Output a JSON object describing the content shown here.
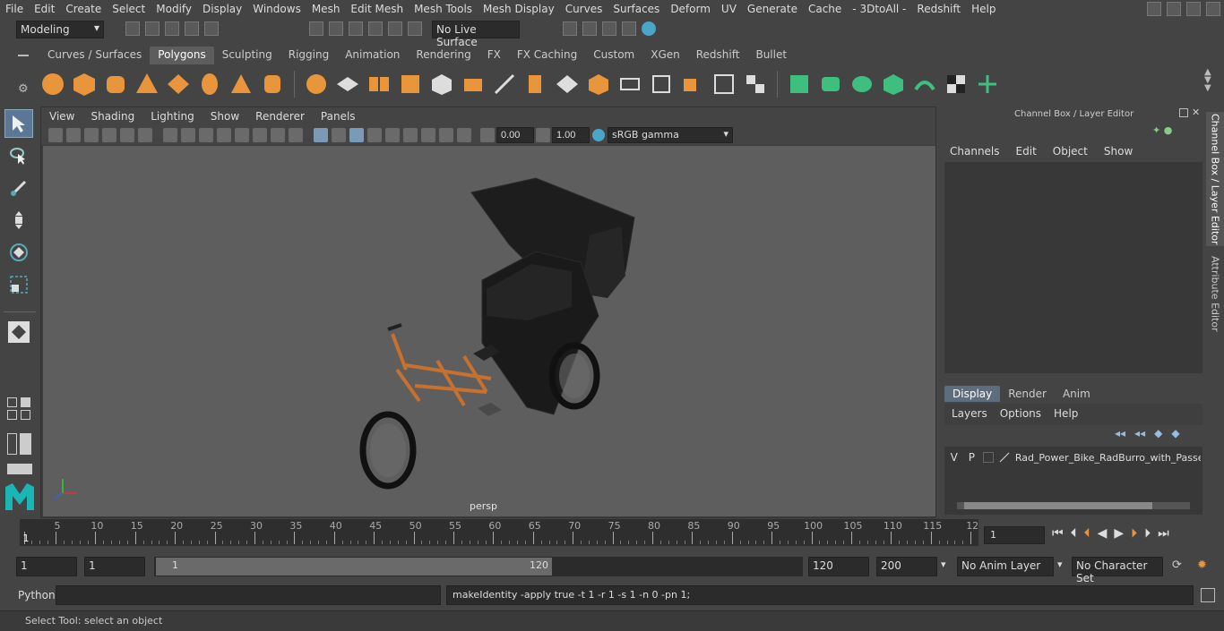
{
  "menubar": {
    "items": [
      "File",
      "Edit",
      "Create",
      "Select",
      "Modify",
      "Display",
      "Windows",
      "Mesh",
      "Edit Mesh",
      "Mesh Tools",
      "Mesh Display",
      "Curves",
      "Surfaces",
      "Deform",
      "UV",
      "Generate",
      "Cache",
      "- 3DtoAll -",
      "Redshift",
      "Help"
    ]
  },
  "statusline": {
    "mode": "Modeling",
    "live_surface": "No Live Surface"
  },
  "shelf": {
    "tabs": [
      "Curves / Surfaces",
      "Polygons",
      "Sculpting",
      "Rigging",
      "Animation",
      "Rendering",
      "FX",
      "FX Caching",
      "Custom",
      "XGen",
      "Redshift",
      "Bullet"
    ],
    "active_tab": "Polygons"
  },
  "panel": {
    "menu": [
      "View",
      "Shading",
      "Lighting",
      "Show",
      "Renderer",
      "Panels"
    ],
    "exposure": "0.00",
    "gamma": "1.00",
    "colorspace": "sRGB gamma",
    "camera_label": "persp"
  },
  "channelbox": {
    "title": "Channel Box / Layer Editor",
    "menu": [
      "Channels",
      "Edit",
      "Object",
      "Show"
    ],
    "layer_tabs": [
      "Display",
      "Render",
      "Anim"
    ],
    "active_layer_tab": "Display",
    "layer_menu": [
      "Layers",
      "Options",
      "Help"
    ],
    "layer": {
      "v": "V",
      "p": "P",
      "name": "Rad_Power_Bike_RadBurro_with_Passeng"
    }
  },
  "side_tabs": [
    "Channel Box / Layer Editor",
    "Attribute Editor"
  ],
  "timeline": {
    "ticks": [
      "1",
      "5",
      "10",
      "15",
      "20",
      "25",
      "30",
      "35",
      "40",
      "45",
      "50",
      "55",
      "60",
      "65",
      "70",
      "75",
      "80",
      "85",
      "90",
      "95",
      "100",
      "105",
      "110",
      "115",
      "12"
    ],
    "current_frame": "1"
  },
  "range": {
    "start": "1",
    "playback_start": "1",
    "slider_start": "1",
    "slider_end": "120",
    "playback_end": "120",
    "end": "200",
    "anim_layer": "No Anim Layer",
    "char_set": "No Character Set"
  },
  "cmdline": {
    "lang": "Python",
    "result": "makeIdentity -apply true -t 1 -r 1 -s 1 -n 0 -pn 1;"
  },
  "helpline": {
    "text": "Select Tool: select an object"
  },
  "colors": {
    "accent": "#5a7896",
    "model_orange": "#c8702e"
  }
}
